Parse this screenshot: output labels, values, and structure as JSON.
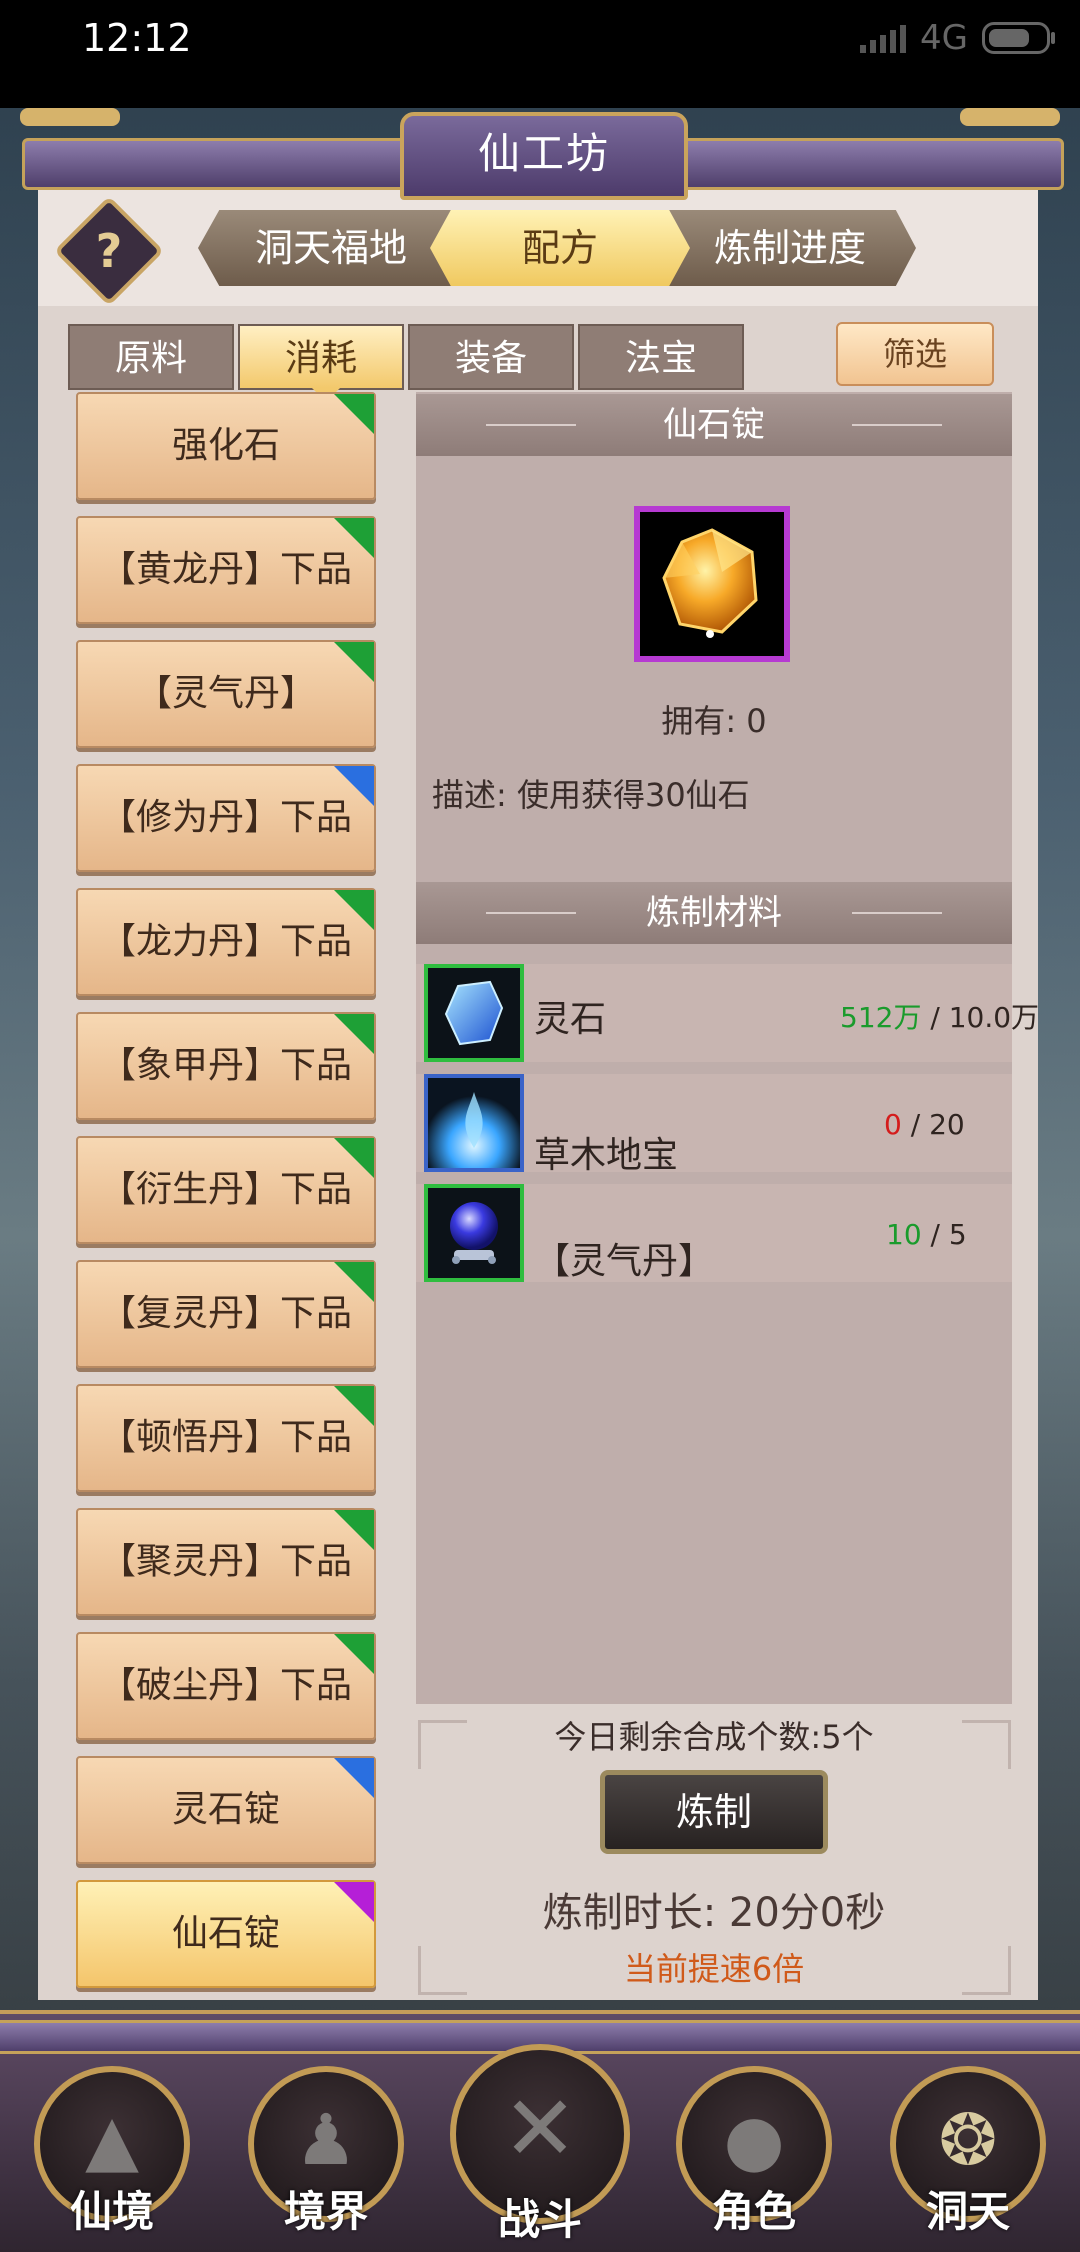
{
  "status_bar": {
    "time": "12:12",
    "network": "4G"
  },
  "window": {
    "title": "仙工坊"
  },
  "top_tabs": [
    {
      "label": "洞天福地"
    },
    {
      "label": "配方"
    },
    {
      "label": "炼制进度"
    }
  ],
  "category_tabs": [
    {
      "label": "原料"
    },
    {
      "label": "消耗"
    },
    {
      "label": "装备"
    },
    {
      "label": "法宝"
    }
  ],
  "filter_label": "筛选",
  "recipe_list": [
    {
      "label": "强化石",
      "rarity": "green"
    },
    {
      "label": "【黄龙丹】下品",
      "rarity": "green"
    },
    {
      "label": "【灵气丹】",
      "rarity": "green"
    },
    {
      "label": "【修为丹】下品",
      "rarity": "blue"
    },
    {
      "label": "【龙力丹】下品",
      "rarity": "green"
    },
    {
      "label": "【象甲丹】下品",
      "rarity": "green"
    },
    {
      "label": "【衍生丹】下品",
      "rarity": "green"
    },
    {
      "label": "【复灵丹】下品",
      "rarity": "green"
    },
    {
      "label": "【顿悟丹】下品",
      "rarity": "green"
    },
    {
      "label": "【聚灵丹】下品",
      "rarity": "green"
    },
    {
      "label": "【破尘丹】下品",
      "rarity": "green"
    },
    {
      "label": "灵石锭",
      "rarity": "blue"
    },
    {
      "label": "仙石锭",
      "rarity": "purple"
    }
  ],
  "detail": {
    "title": "仙石锭",
    "owned": "拥有: 0",
    "description": "描述: 使用获得30仙石",
    "materials_header": "炼制材料",
    "materials": [
      {
        "name": "灵石",
        "have": "512万",
        "need": "10.0万",
        "have_color": "green",
        "icon": "spirit-stone-icon"
      },
      {
        "name": "草木地宝",
        "have": "0",
        "need": "20",
        "have_color": "red",
        "icon": "herb-treasure-icon"
      },
      {
        "name": "【灵气丹】",
        "have": "10",
        "need": "5",
        "have_color": "green",
        "icon": "spirit-pill-icon"
      }
    ],
    "remaining": "今日剩余合成个数:5个",
    "craft_label": "炼制",
    "duration": "炼制时长: 20分0秒",
    "speedup": "当前提速6倍"
  },
  "bottom_nav": [
    {
      "label": "仙境"
    },
    {
      "label": "境界"
    },
    {
      "label": "战斗"
    },
    {
      "label": "角色"
    },
    {
      "label": "洞天"
    }
  ],
  "colors": {
    "rarity_green": "#1ea036",
    "rarity_blue": "#2a6fe0",
    "rarity_purple": "#b51fd7",
    "accent_gold": "#c9a565"
  }
}
